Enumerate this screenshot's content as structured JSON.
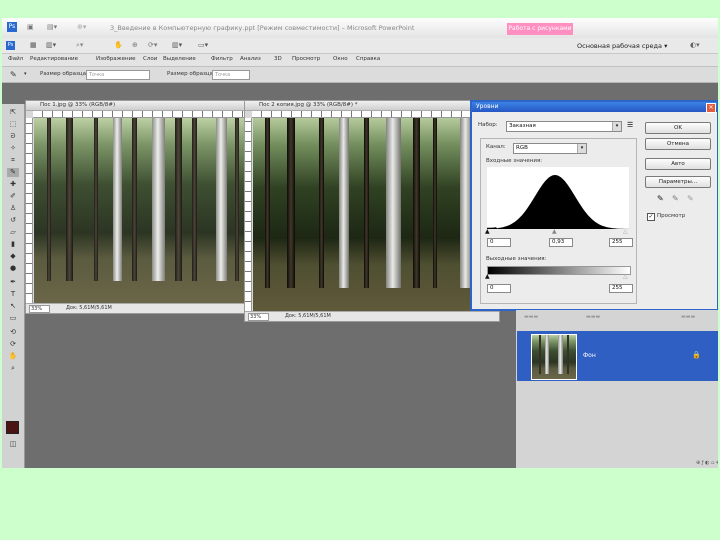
{
  "app": {
    "window_title": "3_Введение в Компьютерную  графику.ppt [Режим совместимости] – Microsoft PowerPoint",
    "selection_button": "Работа с рисунками",
    "workspace": "Основная рабочая среда",
    "workspace_arrow": "▾"
  },
  "menu": [
    "Файл",
    "Редактирование",
    "Изображение",
    "Слои",
    "Выделение",
    "Фильтр",
    "Анализ",
    "3D",
    "Просмотр",
    "Окно",
    "Справка"
  ],
  "options": {
    "sample_label": "Размер образца:",
    "sample_value": "Точка",
    "size_label": "Размер образца:",
    "size_value": "Точка"
  },
  "doc1": {
    "title": "Пос 1.jpg @ 33% (RGB/8#)",
    "zoom": "33%",
    "status": "Док: 5,61M/5,61M"
  },
  "doc2": {
    "title": "Пос 2 копия.jpg @ 33% (RGB/8#) *",
    "zoom": "33%",
    "status": "Док: 5,61M/5,61M"
  },
  "levels": {
    "title": "Уровни",
    "close": "✕",
    "preset_label": "Набор:",
    "preset_value": "Заказная",
    "channel_label": "Канал:",
    "channel_value": "RGB",
    "input_label": "Входные значения:",
    "input_black": "0",
    "input_gamma": "0,93",
    "input_white": "255",
    "output_label": "Выходные значения:",
    "output_black": "0",
    "output_white": "255",
    "ok": "OK",
    "cancel": "Отмена",
    "auto": "Авто",
    "params": "Параметры...",
    "preview_label": "Просмотр",
    "preview_checked": true
  },
  "layers": {
    "name": "Фон"
  },
  "colors": {
    "accent": "#2f5fc3",
    "dialog_title": "#2557c2",
    "selection_tab": "#ff8fc0",
    "foreground": "#4a1414"
  }
}
